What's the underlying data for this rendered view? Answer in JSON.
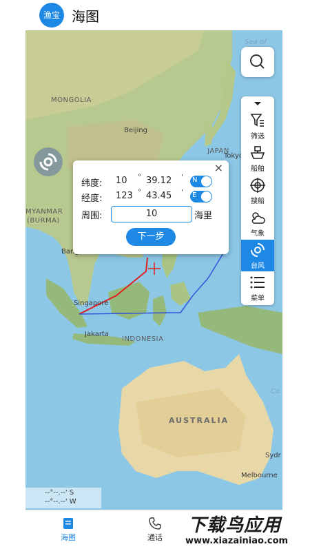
{
  "app": {
    "logo_text": "渔宝",
    "title": "海图"
  },
  "map": {
    "labels": {
      "mongolia": "MONGOLIA",
      "beijing": "Beijing",
      "japan": "JAPAN",
      "tokyo": "Tokyo",
      "myanmar": "MYANMAR",
      "burma": "(BURMA)",
      "bangkok": "Bangk",
      "singapore": "Singapore",
      "jakarta": "Jakarta",
      "indonesia": "INDONESIA",
      "australia": "AUSTRALIA",
      "sydney": "Sydr",
      "melbourne": "Melbourne",
      "sea_of": "Sea of",
      "coral": "Co"
    }
  },
  "tools": [
    {
      "label": "筛选",
      "icon": "filter-icon"
    },
    {
      "label": "船舶",
      "icon": "ship-icon"
    },
    {
      "label": "搜船",
      "icon": "crosshair-icon"
    },
    {
      "label": "气象",
      "icon": "weather-icon"
    },
    {
      "label": "台风",
      "icon": "typhoon-icon",
      "active": true
    },
    {
      "label": "菜单",
      "icon": "menu-icon"
    }
  ],
  "dialog": {
    "close": "×",
    "lat_label": "纬度:",
    "lat_deg": "10",
    "lat_deg_unit": "°",
    "lat_min": "39.12",
    "lat_min_unit": "'",
    "lat_dir": "N",
    "lon_label": "经度:",
    "lon_deg": "123",
    "lon_deg_unit": "°",
    "lon_min": "43.45",
    "lon_min_unit": "'",
    "lon_dir": "E",
    "range_label": "周围:",
    "range_value": "10",
    "range_unit": "海里",
    "next_button": "下一步"
  },
  "scale": {
    "line1": "--°--.--' S",
    "line2": "--°--.--' W"
  },
  "bottom_nav": [
    {
      "label": "海图",
      "icon": "chart-icon",
      "active": true
    },
    {
      "label": "通话",
      "icon": "phone-icon"
    }
  ],
  "watermark": {
    "line1": "下载鸟应用",
    "line2": "www.xiazainiao.com"
  },
  "colors": {
    "accent": "#1e88e5",
    "track_red": "#e02020",
    "track_blue": "#3355dd"
  }
}
